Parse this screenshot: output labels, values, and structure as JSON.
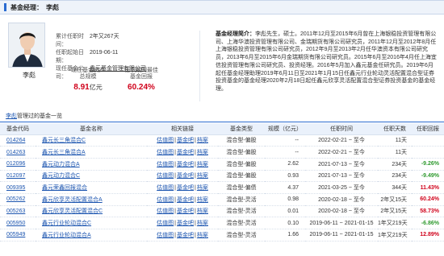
{
  "header": {
    "title": "基金经理：",
    "manager": "李彪"
  },
  "profile": {
    "name": "李彪",
    "meta": [
      {
        "key": "累计任职时间：",
        "value": "2年又267天"
      },
      {
        "key": "任职起始日期：",
        "value": "2019-06-11"
      },
      {
        "key": "现任基金公司：",
        "value": "鑫元基金管理有限公司",
        "link": true
      }
    ],
    "stats": [
      {
        "label1": "现任基金资产",
        "label2": "总规模",
        "value": "8.91",
        "unit": "亿元"
      },
      {
        "label1": "任职期间最佳",
        "label2": "基金回报",
        "value": "60.24%"
      }
    ],
    "bio_title": "基金经理简介：",
    "bio": "李彪先生，硕士。2011年12月至2015年6月曾在上海银稳投资管理有限公司、上海华澳投资管理有限公司、金瑞期货有限公司研究员，2011年12月至2012年8月任上海银稳投资管理有限公司研究员，2012年9月至2013年2月任华澳资本有限公司研究员，2013年6月至2015年6月金瑞期货有限公司研究员。2015年6月至2016年4月任上海宜信投资管理有限公司研究员、投资经理。2016年5月加入鑫元基金任研究员。2019年6月起任基金经理助理2019年6月11日至2021年1月15日任鑫元行业轮动灵活配置混合型证券投资基金的基金经理2020年2月18日起任鑫元欣享灵活配置混合型证券投资基金的基金经理。"
  },
  "section": {
    "name": "李彪",
    "text": "管理过的基金一览"
  },
  "table": {
    "headers": [
      "基金代码",
      "基金名称",
      "相关链接",
      "基金类型",
      "规模（亿元）",
      "任职时间",
      "任职天数",
      "任职回报"
    ],
    "link_labels": [
      "估值图",
      "基金吧",
      "档案"
    ],
    "rows": [
      {
        "code": "014264",
        "name": "鑫元长三角混合C",
        "type": "混合型-偏股",
        "scale": "--",
        "term": "2022-02-21 ~ 至今",
        "days": "11天",
        "ret": "",
        "sign": ""
      },
      {
        "code": "014263",
        "name": "鑫元长三角混合A",
        "type": "混合型-偏股",
        "scale": "--",
        "term": "2022-02-21 ~ 至今",
        "days": "11天",
        "ret": "",
        "sign": ""
      },
      {
        "code": "012096",
        "name": "鑫元动力混合A",
        "type": "混合型-偏股",
        "scale": "2.62",
        "term": "2021-07-13 ~ 至今",
        "days": "234天",
        "ret": "-9.26%",
        "sign": "neg"
      },
      {
        "code": "012097",
        "name": "鑫元动力混合C",
        "type": "混合型-偏股",
        "scale": "0.93",
        "term": "2021-07-13 ~ 至今",
        "days": "234天",
        "ret": "-9.49%",
        "sign": "neg"
      },
      {
        "code": "009395",
        "name": "鑫元荣鑫回报混合",
        "type": "混合型-偏债",
        "scale": "4.37",
        "term": "2021-03-25 ~ 至今",
        "days": "344天",
        "ret": "11.43%",
        "sign": "pos"
      },
      {
        "code": "005262",
        "name": "鑫元欣享灵活配置混合A",
        "type": "混合型-灵活",
        "scale": "0.98",
        "term": "2020-02-18 ~ 至今",
        "days": "2年又15天",
        "ret": "60.24%",
        "sign": "pos"
      },
      {
        "code": "005263",
        "name": "鑫元欣享灵活配置混合C",
        "type": "混合型-灵活",
        "scale": "0.01",
        "term": "2020-02-18 ~ 至今",
        "days": "2年又15天",
        "ret": "58.73%",
        "sign": "pos"
      },
      {
        "code": "005950",
        "name": "鑫元行业轮动混合C",
        "type": "混合型-灵活",
        "scale": "0.10",
        "term": "2019-06-11 ~ 2021-01-15",
        "days": "1年又219天",
        "ret": "-6.86%",
        "sign": "neg"
      },
      {
        "code": "005949",
        "name": "鑫元行业轮动混合A",
        "type": "混合型-灵活",
        "scale": "1.66",
        "term": "2019-06-11 ~ 2021-01-15",
        "days": "1年又219天",
        "ret": "12.89%",
        "sign": "pos"
      }
    ]
  }
}
